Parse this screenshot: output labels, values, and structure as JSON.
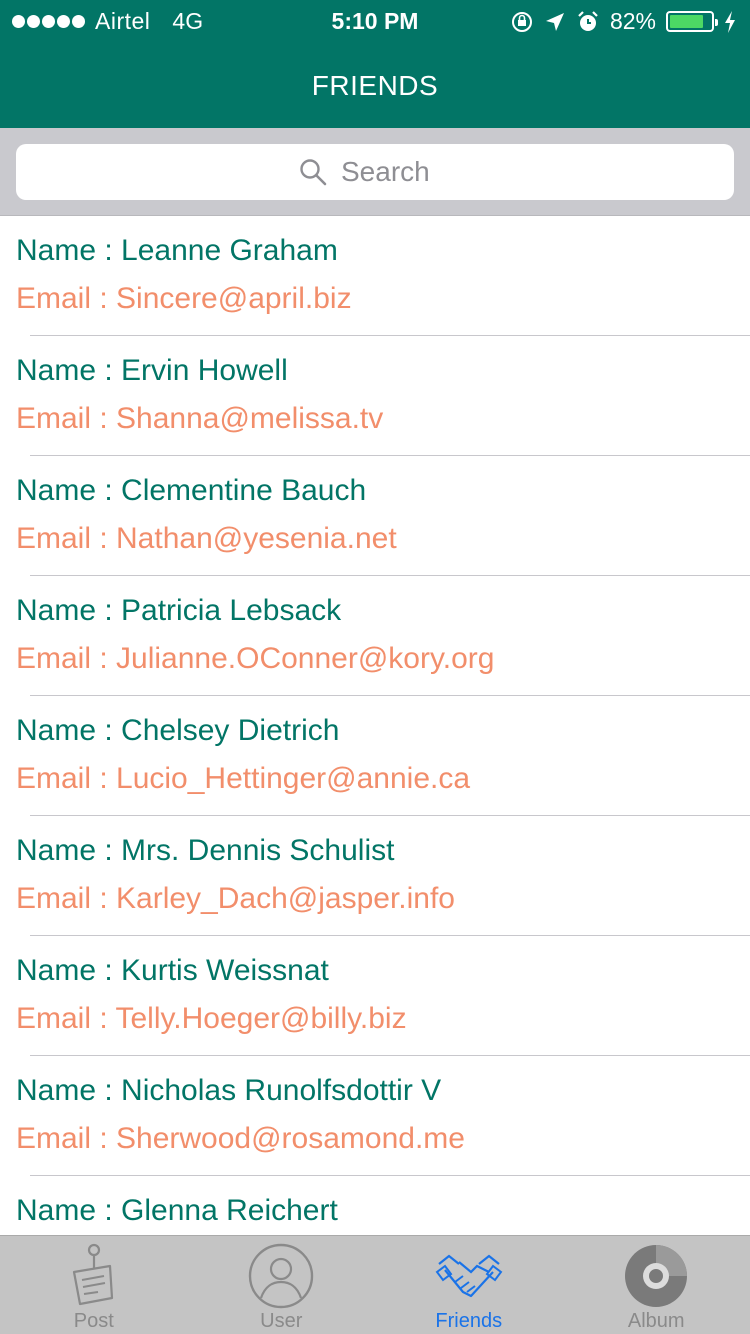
{
  "status": {
    "carrier": "Airtel",
    "network": "4G",
    "time": "5:10 PM",
    "battery": "82%",
    "battery_level": 0.82
  },
  "nav": {
    "title": "FRIENDS"
  },
  "search": {
    "placeholder": "Search",
    "value": ""
  },
  "friends": [
    {
      "name": "Name : Leanne Graham",
      "email": "Email : Sincere@april.biz"
    },
    {
      "name": "Name : Ervin Howell",
      "email": "Email : Shanna@melissa.tv"
    },
    {
      "name": "Name : Clementine Bauch",
      "email": "Email : Nathan@yesenia.net"
    },
    {
      "name": "Name : Patricia Lebsack",
      "email": "Email : Julianne.OConner@kory.org"
    },
    {
      "name": "Name : Chelsey Dietrich",
      "email": "Email : Lucio_Hettinger@annie.ca"
    },
    {
      "name": "Name : Mrs. Dennis Schulist",
      "email": "Email : Karley_Dach@jasper.info"
    },
    {
      "name": "Name : Kurtis Weissnat",
      "email": "Email : Telly.Hoeger@billy.biz"
    },
    {
      "name": "Name : Nicholas Runolfsdottir V",
      "email": "Email : Sherwood@rosamond.me"
    },
    {
      "name": "Name : Glenna Reichert",
      "email": ""
    }
  ],
  "tabs": [
    {
      "label": "Post",
      "icon": "post-icon"
    },
    {
      "label": "User",
      "icon": "user-icon"
    },
    {
      "label": "Friends",
      "icon": "handshake-icon",
      "active": true
    },
    {
      "label": "Album",
      "icon": "album-icon"
    }
  ],
  "colors": {
    "primary": "#027566",
    "email": "#f28e6b",
    "active_tab": "#1a73e8",
    "tabbar": "#c4c4c4"
  }
}
